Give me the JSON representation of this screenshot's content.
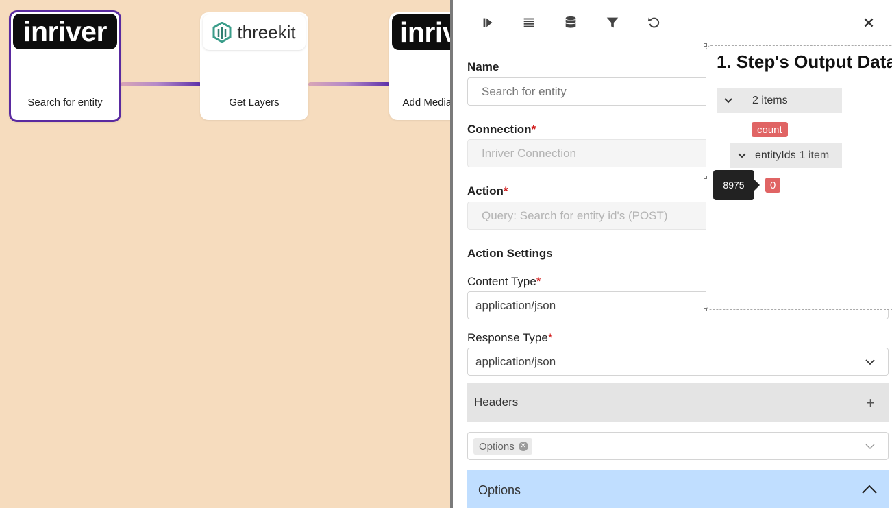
{
  "canvas": {
    "nodes": [
      {
        "logo": "inriver",
        "label": "Search for entity"
      },
      {
        "logo": "threekit",
        "label": "Get Layers"
      },
      {
        "logo": "inriv",
        "label": "Add Media Url"
      }
    ]
  },
  "toolbar": {
    "icons": [
      "step-forward-icon",
      "list-icon",
      "database-icon",
      "filter-icon",
      "undo-icon",
      "close-icon"
    ]
  },
  "form": {
    "name_label": "Name",
    "name_placeholder": "Search for entity",
    "connection_label": "Connection",
    "connection_value": "Inriver Connection",
    "action_label": "Action",
    "action_value": "Query: Search for entity id's (POST)",
    "action_settings_label": "Action Settings",
    "content_type_label": "Content Type",
    "content_type_value": "application/json",
    "response_type_label": "Response Type",
    "response_type_value": "application/json",
    "required_mark": "*",
    "headers_label": "Headers",
    "headers_add": "+",
    "options_tag": "Options",
    "options_section_label": "Options"
  },
  "output_panel": {
    "title": "1. Step's Output Data",
    "root_summary": "2 items",
    "key_count": "count",
    "key_entity_ids": "entityIds",
    "entity_ids_summary": "1 item",
    "index_key": "0",
    "tooltip_value": "8975"
  }
}
